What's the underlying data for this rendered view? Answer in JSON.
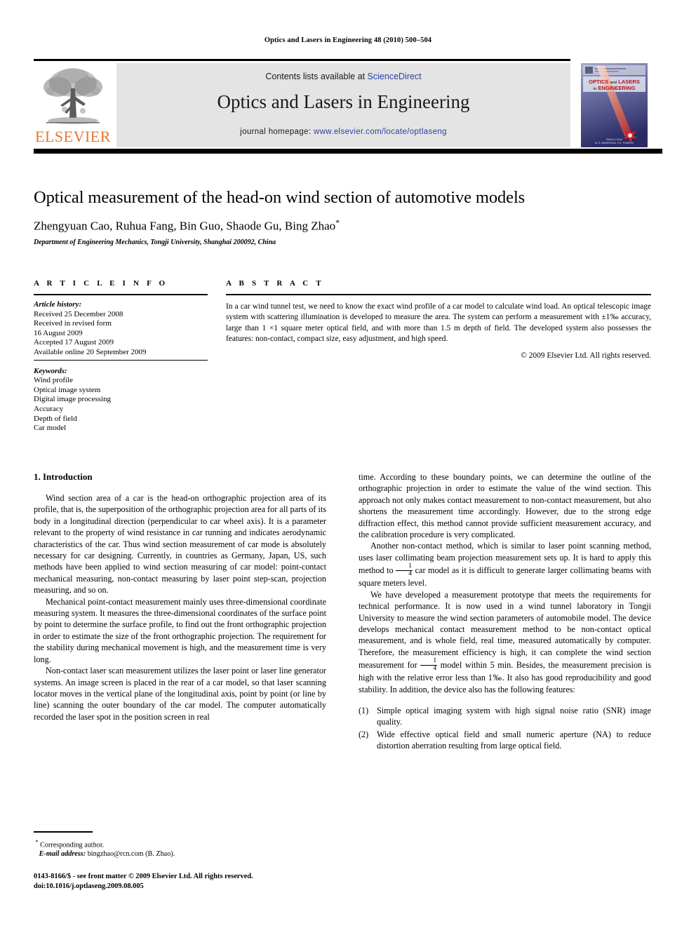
{
  "running_head": "Optics and Lasers in Engineering 48 (2010) 500–504",
  "masthead": {
    "contents_prefix": "Contents lists available at ",
    "sciencedirect": "ScienceDirect",
    "journal_name": "Optics and Lasers in Engineering",
    "homepage_prefix": "journal homepage: ",
    "homepage_url": "www.elsevier.com/locate/optlaseng",
    "publisher_wordmark": "ELSEVIER",
    "link_color": "#2b3fa0",
    "wordmark_color": "#E8762C",
    "panel_color": "#e4e4e4",
    "cover": {
      "line1": "OPTICS and LASERS",
      "line2": "in ENGINEERING",
      "title_color": "#b7121f",
      "bg_top": "#9aa0c8",
      "bg_bottom": "#2f2f6b"
    }
  },
  "article": {
    "title": "Optical measurement of the head-on wind section of automotive models",
    "authors": "Zhengyuan Cao, Ruhua Fang, Bin Guo, Shaode Gu, Bing Zhao",
    "corresponding_marker": "*",
    "affiliation": "Department of Engineering Mechanics, Tongji University, Shanghai 200092, China"
  },
  "info": {
    "heading": "A R T I C L E   I N F O",
    "history_label": "Article history:",
    "history": [
      "Received 25 December 2008",
      "Received in revised form",
      "16 August 2009",
      "Accepted 17 August 2009",
      "Available online 20 September 2009"
    ],
    "keywords_label": "Keywords:",
    "keywords": [
      "Wind profile",
      "Optical image system",
      "Digital image processing",
      "Accuracy",
      "Depth of field",
      "Car model"
    ]
  },
  "abstract": {
    "heading": "A B S T R A C T",
    "text": "In a car wind tunnel test, we need to know the exact wind profile of a car model to calculate wind load. An optical telescopic image system with scattering illumination is developed to measure the area. The system can perform a measurement with ±1‰ accuracy, large than 1 ×1 square meter optical field, and with more than 1.5 m depth of field. The developed system also possesses the features: non-contact, compact size, easy adjustment, and high speed.",
    "copyright": "© 2009 Elsevier Ltd. All rights reserved."
  },
  "body": {
    "section_heading": "1. Introduction",
    "left_paragraphs": [
      "Wind section area of a car is the head-on orthographic projection area of its profile, that is, the superposition of the orthographic projection area for all parts of its body in a longitudinal direction (perpendicular to car wheel axis). It is a parameter relevant to the property of wind resistance in car running and indicates aerodynamic characteristics of the car. Thus wind section measurement of car mode is absolutely necessary for car designing. Currently, in countries as Germany, Japan, US, such methods have been applied to wind section measuring of car model: point-contact mechanical measuring, non-contact measuring by laser point step-scan, projection measuring, and so on.",
      "Mechanical point-contact measurement mainly uses three-dimensional coordinate measuring system. It measures the three-dimensional coordinates of the surface point by point to determine the surface profile, to find out the front orthographic projection in order to estimate the size of the front orthographic projection. The requirement for the stability during mechanical movement is high, and the measurement time is very long.",
      "Non-contact laser scan measurement utilizes the laser point or laser line generator systems. An image screen is placed in the rear of a car model, so that laser scanning locator moves in the vertical plane of the longitudinal axis, point by point (or line by line) scanning the outer boundary of the car model. The computer automatically recorded the laser spot in the position screen in real"
    ],
    "right_paragraph_continued": "time. According to these boundary points, we can determine the outline of the orthographic projection in order to estimate the value of the wind section. This approach not only makes contact measurement to non-contact measurement, but also shortens the measurement time accordingly. However, due to the strong edge diffraction effect, this method cannot provide sufficient measurement accuracy, and the calibration procedure is very complicated.",
    "right_paragraph_2_a": "Another non-contact method, which is similar to laser point scanning method, uses laser collimating beam projection measurement sets up. It is hard to apply this method to ",
    "right_paragraph_2_b": " car model as it is difficult to generate larger collimating beams with square meters level.",
    "right_paragraph_3_a": "We have developed a measurement prototype that meets the requirements for technical performance. It is now used in a wind tunnel laboratory in Tongji University to measure the wind section parameters of automobile model. The device develops mechanical contact measurement method to be non-contact optical measurement, and is whole field, real time, measured automatically by computer. Therefore, the measurement efficiency is high, it can complete the wind section measurement for ",
    "right_paragraph_3_b": " model within 5 min. Besides, the measurement precision is high with the relative error less than 1‰. It also has good reproducibility and good stability. In addition, the device also has the following features:",
    "fraction_numerator": "1",
    "fraction_denominator": "4",
    "features": [
      {
        "num": "(1)",
        "text": "Simple optical imaging system with high signal noise ratio (SNR) image quality."
      },
      {
        "num": "(2)",
        "text": "Wide effective optical field and small numeric aperture (NA) to reduce distortion aberration resulting from large optical field."
      }
    ]
  },
  "footer": {
    "corresponding_marker": "*",
    "corresponding_label": "Corresponding author.",
    "email_label": "E-mail address:",
    "email": "bingzhao@rcn.com (B. Zhao).",
    "issn_line": "0143-8166/$ - see front matter © 2009 Elsevier Ltd. All rights reserved.",
    "doi_line": "doi:10.1016/j.optlaseng.2009.08.005"
  }
}
